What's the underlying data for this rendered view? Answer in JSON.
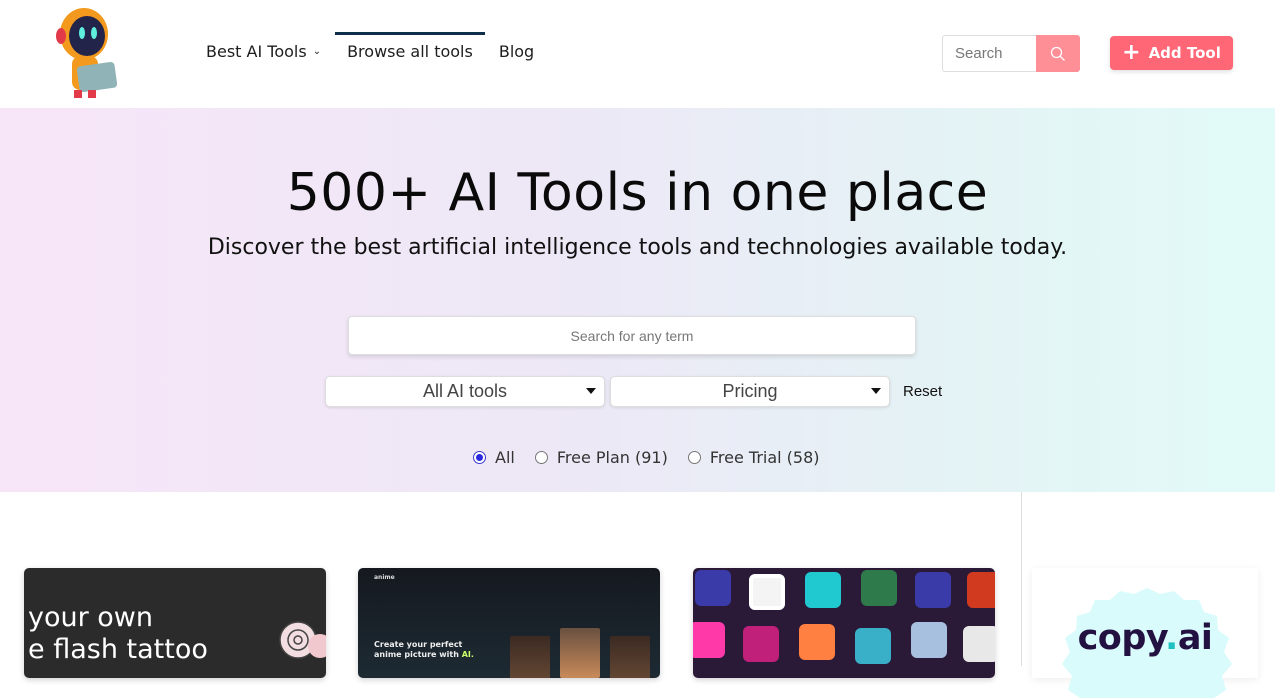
{
  "header": {
    "logo_alt": "AI robot logo",
    "nav": [
      {
        "label": "Best AI Tools",
        "has_dropdown": true
      },
      {
        "label": "Browse all tools",
        "active": true
      },
      {
        "label": "Blog"
      }
    ],
    "search_placeholder": "Search",
    "add_tool_label": "Add Tool"
  },
  "hero": {
    "title": "500+ AI Tools in one place",
    "subtitle": "Discover the best artificial intelligence tools and technologies available today.",
    "term_placeholder": "Search for any term",
    "category_select": "All AI tools",
    "pricing_select": "Pricing",
    "reset_label": "Reset",
    "radios": [
      {
        "label": "All",
        "checked": true
      },
      {
        "label": "Free Plan (91)",
        "checked": false
      },
      {
        "label": "Free Trial (58)",
        "checked": false
      }
    ]
  },
  "cards": [
    {
      "text_line1": "your own",
      "text_line2": "e flash tattoo"
    },
    {
      "brand": "anime",
      "headline": "Create your perfect anime picture with",
      "headline_accent": "AI."
    },
    {
      "description": "grid of AI art thumbnails"
    }
  ],
  "sidebar": {
    "ad_brand_1": "copy",
    "ad_brand_dot": ".",
    "ad_brand_2": "ai"
  },
  "colors": {
    "accent": "#ff6676",
    "search_button": "#ff8f96",
    "nav_active": "#0e2e4a",
    "copyai_dot": "#1ec0c0"
  }
}
